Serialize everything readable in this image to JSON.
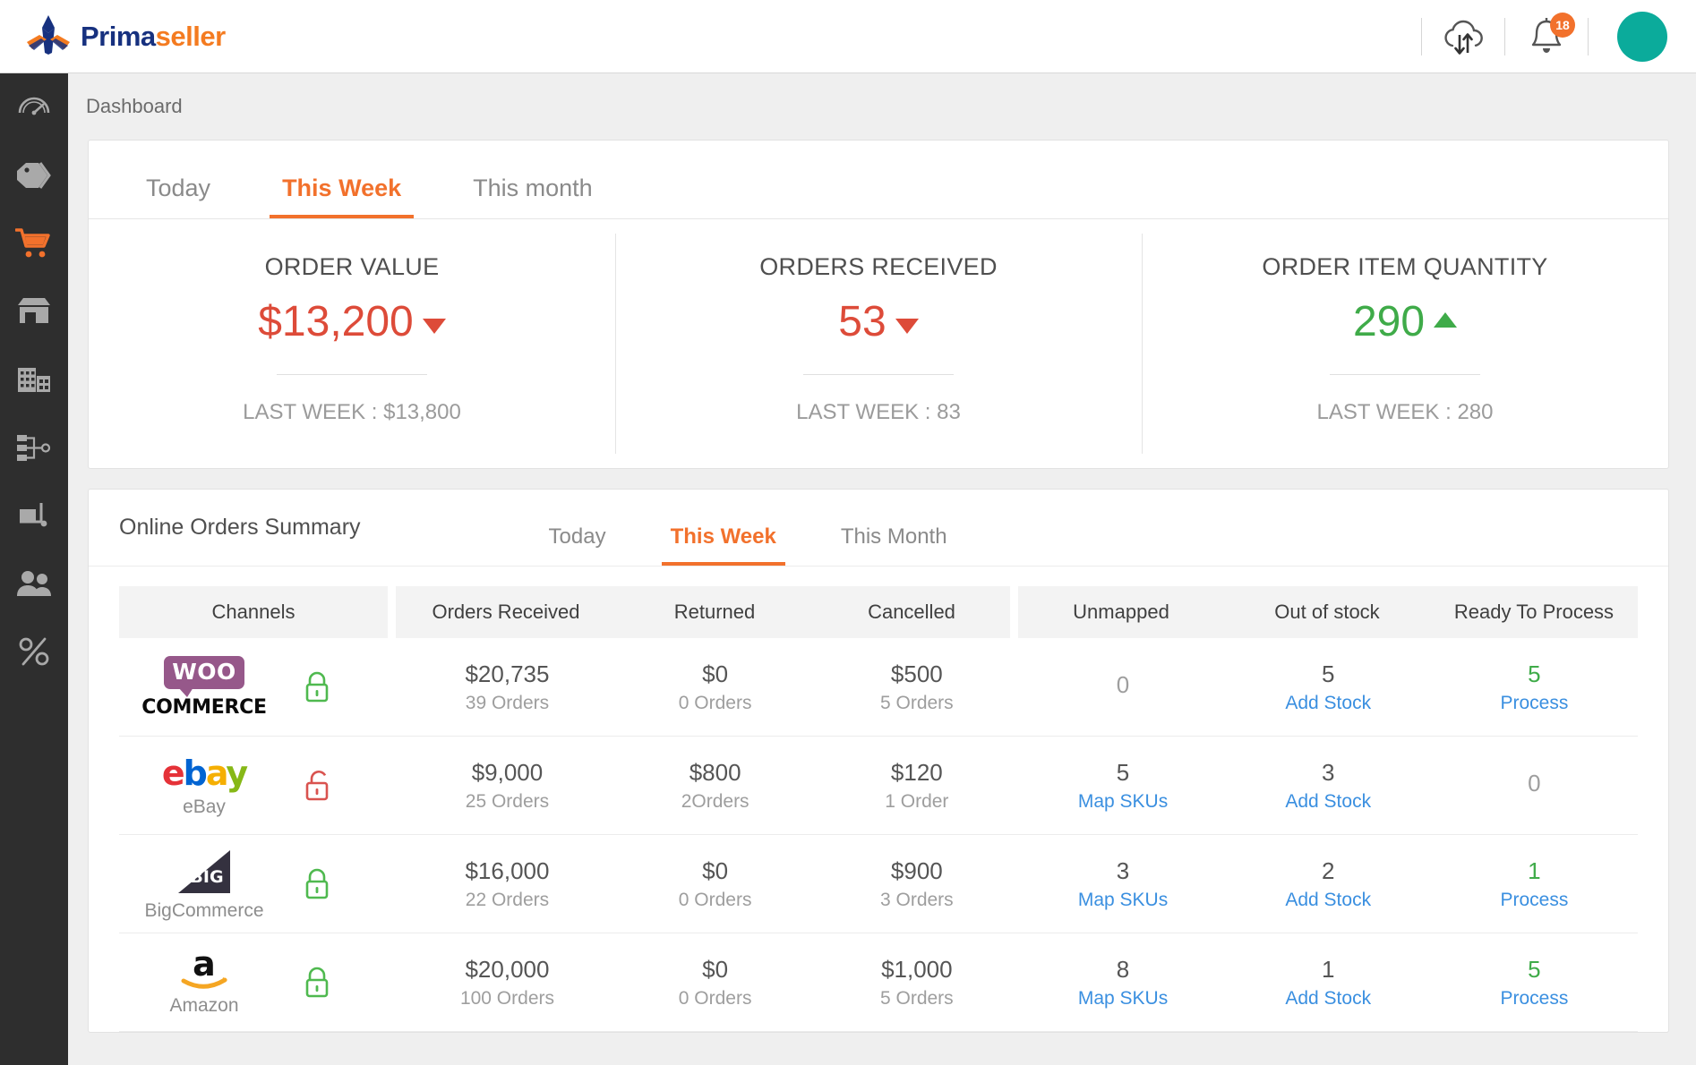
{
  "app": {
    "logo_prima": "Prima",
    "logo_seller": "seller"
  },
  "topbar": {
    "sync_icon": "cloud-sync-icon",
    "notifications_icon": "bell-icon",
    "notification_count": "18",
    "avatar": "user-avatar"
  },
  "sidebar": {
    "items": [
      {
        "name": "dashboard",
        "icon": "gauge-icon",
        "active": false
      },
      {
        "name": "catalog",
        "icon": "tag-icon",
        "active": false
      },
      {
        "name": "orders",
        "icon": "shopping-cart-icon",
        "active": true
      },
      {
        "name": "stores",
        "icon": "store-icon",
        "active": false
      },
      {
        "name": "warehouses",
        "icon": "building-icon",
        "active": false
      },
      {
        "name": "workflow",
        "icon": "workflow-icon",
        "active": false
      },
      {
        "name": "shipping",
        "icon": "pallet-icon",
        "active": false
      },
      {
        "name": "customers",
        "icon": "users-icon",
        "active": false
      },
      {
        "name": "taxes",
        "icon": "percent-icon",
        "active": false
      }
    ]
  },
  "breadcrumb": {
    "label": "Dashboard"
  },
  "kpi_card": {
    "tabs": [
      {
        "label": "Today",
        "active": false
      },
      {
        "label": "This Week",
        "active": true
      },
      {
        "label": "This month",
        "active": false
      }
    ],
    "metrics": [
      {
        "title": "ORDER VALUE",
        "value": "$13,200",
        "trend": "down",
        "last_label": "LAST WEEK :",
        "last_value": "$13,800"
      },
      {
        "title": "ORDERS RECEIVED",
        "value": "53",
        "trend": "down",
        "last_label": "LAST WEEK :",
        "last_value": "83"
      },
      {
        "title": "ORDER ITEM QUANTITY",
        "value": "290",
        "trend": "up",
        "last_label": "LAST WEEK :",
        "last_value": "280"
      }
    ]
  },
  "orders_summary": {
    "title": "Online Orders Summary",
    "tabs": [
      {
        "label": "Today",
        "active": false
      },
      {
        "label": "This Week",
        "active": true
      },
      {
        "label": "This Month",
        "active": false
      }
    ],
    "columns": [
      "Channels",
      "Orders Received",
      "Returned",
      "Cancelled",
      "Unmapped",
      "Out of stock",
      "Ready To Process"
    ],
    "rows": [
      {
        "channel": "WooCommerce",
        "channel_label": "",
        "logo": "woocommerce-logo",
        "lock": "locked",
        "lock_state": "closed",
        "orders_received": "$20,735",
        "orders_received_sub": "39 Orders",
        "returned": "$0",
        "returned_sub": "0 Orders",
        "cancelled": "$500",
        "cancelled_sub": "5 Orders",
        "unmapped": "0",
        "unmapped_link": "",
        "out_of_stock": "5",
        "out_of_stock_link": "Add Stock",
        "ready": "5",
        "ready_link": "Process",
        "ready_green": true
      },
      {
        "channel": "eBay",
        "channel_label": "eBay",
        "logo": "ebay-logo",
        "lock": "unlocked",
        "lock_state": "open",
        "orders_received": "$9,000",
        "orders_received_sub": "25 Orders",
        "returned": "$800",
        "returned_sub": "2Orders",
        "cancelled": "$120",
        "cancelled_sub": "1 Order",
        "unmapped": "5",
        "unmapped_link": "Map SKUs",
        "out_of_stock": "3",
        "out_of_stock_link": "Add Stock",
        "ready": "0",
        "ready_link": "",
        "ready_green": false
      },
      {
        "channel": "BigCommerce",
        "channel_label": "BigCommerce",
        "logo": "bigcommerce-logo",
        "lock": "locked",
        "lock_state": "closed",
        "orders_received": "$16,000",
        "orders_received_sub": "22 Orders",
        "returned": "$0",
        "returned_sub": "0 Orders",
        "cancelled": "$900",
        "cancelled_sub": "3 Orders",
        "unmapped": "3",
        "unmapped_link": "Map SKUs",
        "out_of_stock": "2",
        "out_of_stock_link": "Add Stock",
        "ready": "1",
        "ready_link": "Process",
        "ready_green": true
      },
      {
        "channel": "Amazon",
        "channel_label": "Amazon",
        "logo": "amazon-logo",
        "lock": "locked",
        "lock_state": "closed",
        "orders_received": "$20,000",
        "orders_received_sub": "100 Orders",
        "returned": "$0",
        "returned_sub": "0 Orders",
        "cancelled": "$1,000",
        "cancelled_sub": "5 Orders",
        "unmapped": "8",
        "unmapped_link": "Map SKUs",
        "out_of_stock": "1",
        "out_of_stock_link": "Add Stock",
        "ready": "5",
        "ready_link": "Process",
        "ready_green": true
      }
    ]
  },
  "colors": {
    "brand_orange": "#f2712c",
    "brand_navy": "#17317f",
    "down_red": "#dd4b39",
    "up_green": "#3fab49",
    "link_blue": "#3a8fe0",
    "sidebar_dark": "#2e2e2e",
    "avatar_teal": "#0bab9b"
  }
}
